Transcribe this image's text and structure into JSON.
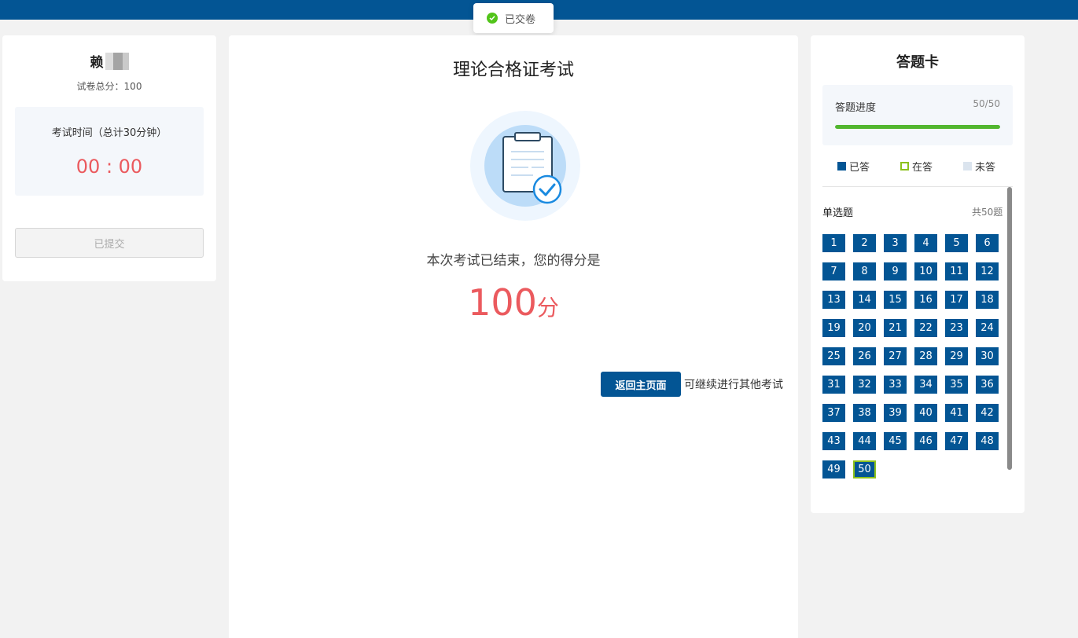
{
  "toast": {
    "text": "已交卷"
  },
  "left": {
    "user_name": "赖",
    "total_score_text": "试卷总分：100",
    "timer_label": "考试时间（总计30分钟）",
    "timer_value": "00 : 00",
    "submit_label": "已提交"
  },
  "center": {
    "title": "理论合格证考试",
    "result_text": "本次考试已结束，您的得分是",
    "score": "100",
    "score_unit": "分",
    "back_button": "返回主页面",
    "continue_text": "可继续进行其他考试"
  },
  "answer_card": {
    "title": "答题卡",
    "progress_label": "答题进度",
    "progress_count": "50/50",
    "progress_fraction": 1.0,
    "legend": {
      "answered": "已答",
      "current": "在答",
      "unanswered": "未答"
    },
    "section_label": "单选题",
    "section_count": "共50题",
    "questions": [
      "1",
      "2",
      "3",
      "4",
      "5",
      "6",
      "7",
      "8",
      "9",
      "10",
      "11",
      "12",
      "13",
      "14",
      "15",
      "16",
      "17",
      "18",
      "19",
      "20",
      "21",
      "22",
      "23",
      "24",
      "25",
      "26",
      "27",
      "28",
      "29",
      "30",
      "31",
      "32",
      "33",
      "34",
      "35",
      "36",
      "37",
      "38",
      "39",
      "40",
      "41",
      "42",
      "43",
      "44",
      "45",
      "46",
      "47",
      "48",
      "49",
      "50"
    ],
    "current_question": "50"
  },
  "colors": {
    "brand": "#035594",
    "accent_red": "#eb5a5e",
    "success_green": "#52b62f",
    "current_border": "#8cc11c"
  }
}
